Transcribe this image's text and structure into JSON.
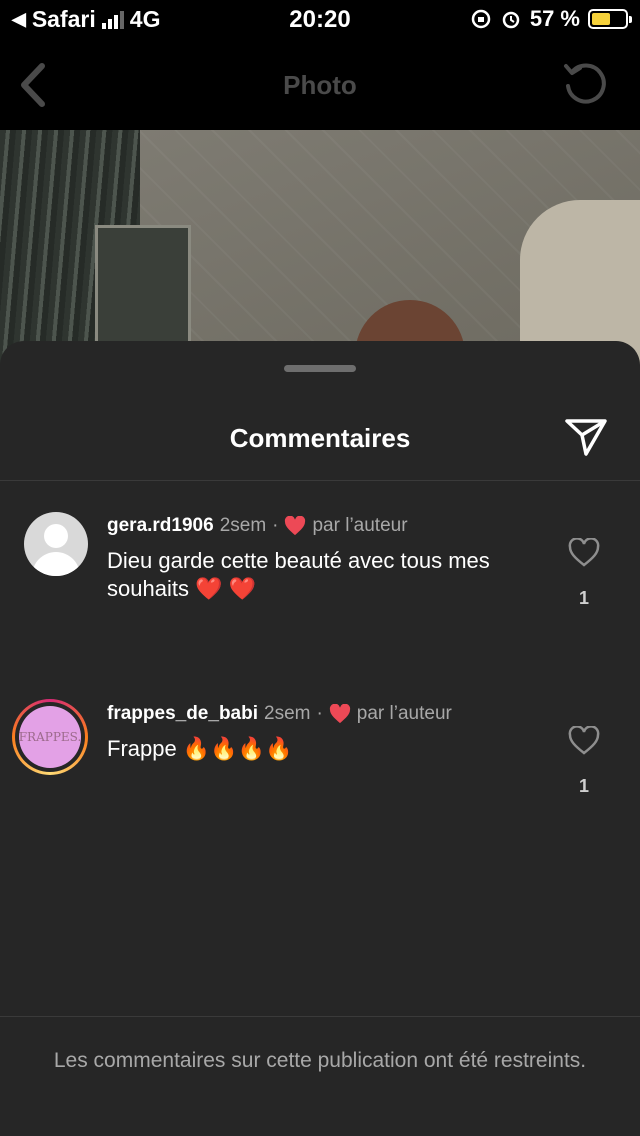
{
  "status_bar": {
    "back_app": "Safari",
    "network": "4G",
    "time": "20:20",
    "battery": "57 %",
    "battery_level": 0.57
  },
  "nav": {
    "title": "Photo",
    "back_icon": "chevron-left-icon",
    "reload_icon": "refresh-icon"
  },
  "sheet": {
    "title": "Commentaires",
    "send_icon": "paper-plane-icon"
  },
  "comments": [
    {
      "username": "gera.rd1906",
      "time": "2sem",
      "separator": "·",
      "liked_label": "par l’auteur",
      "text": "Dieu garde cette beauté avec tous mes souhaits ❤️ ❤️",
      "likes": "1"
    },
    {
      "username": "frappes_de_babi",
      "avatar_text": "FRAPPES.",
      "time": "2sem",
      "separator": "·",
      "liked_label": "par l’auteur",
      "text": "Frappe 🔥🔥🔥🔥",
      "likes": "1"
    }
  ],
  "footer": {
    "restricted_text": "Les commentaires sur cette publication ont été restreints."
  },
  "colors": {
    "sheet_bg": "#262626",
    "heart_red": "#ed4956",
    "battery_yellow": "#f5d13b"
  }
}
